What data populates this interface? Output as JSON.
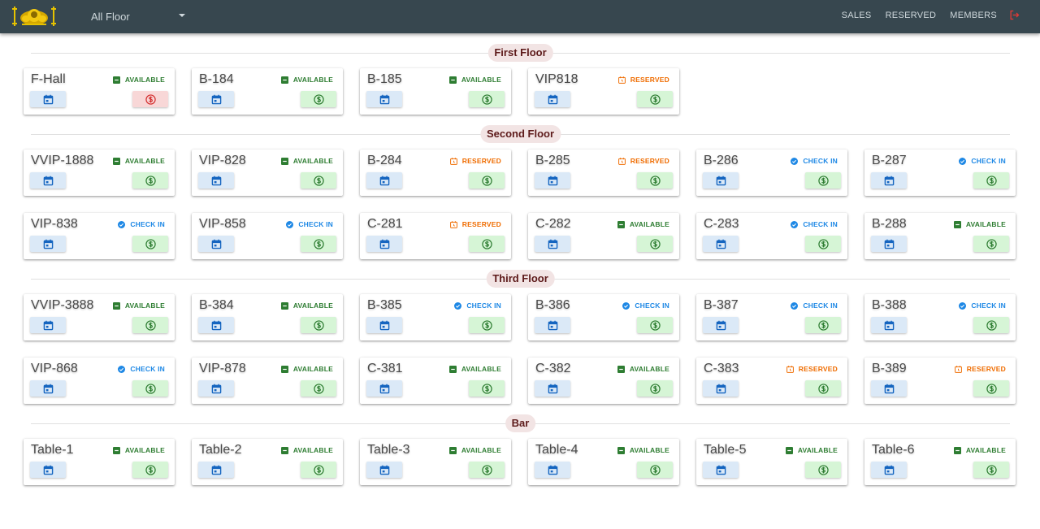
{
  "header": {
    "floor_select": "All Floor",
    "nav": [
      "SALES",
      "RESERVED",
      "MEMBERS"
    ]
  },
  "colors": {
    "topbar": "#37474f",
    "available": "#2e7d32",
    "reserved": "#ef6c00",
    "checkin": "#1e88e5",
    "calendar_button": "#dbe9f7",
    "pay_button": "#d6f5d6",
    "pay_button_busy": "#f8d7d7",
    "chip": "#f2e4e4"
  },
  "status_labels": {
    "available": "AVAILABLE",
    "reserved": "RESERVED",
    "checkin": "CHECK IN"
  },
  "sections": [
    {
      "title": "First Floor",
      "rows": [
        [
          {
            "name": "F-Hall",
            "status": "available",
            "pay": "busy"
          },
          {
            "name": "B-184",
            "status": "available"
          },
          {
            "name": "B-185",
            "status": "available"
          },
          {
            "name": "VIP818",
            "status": "reserved"
          }
        ]
      ]
    },
    {
      "title": "Second Floor",
      "rows": [
        [
          {
            "name": "VVIP-1888",
            "status": "available"
          },
          {
            "name": "VIP-828",
            "status": "available"
          },
          {
            "name": "B-284",
            "status": "reserved"
          },
          {
            "name": "B-285",
            "status": "reserved"
          },
          {
            "name": "B-286",
            "status": "checkin"
          },
          {
            "name": "B-287",
            "status": "checkin"
          }
        ],
        [
          {
            "name": "VIP-838",
            "status": "checkin"
          },
          {
            "name": "VIP-858",
            "status": "checkin"
          },
          {
            "name": "C-281",
            "status": "reserved"
          },
          {
            "name": "C-282",
            "status": "available"
          },
          {
            "name": "C-283",
            "status": "checkin"
          },
          {
            "name": "B-288",
            "status": "available"
          }
        ]
      ]
    },
    {
      "title": "Third Floor",
      "rows": [
        [
          {
            "name": "VVIP-3888",
            "status": "available"
          },
          {
            "name": "B-384",
            "status": "available"
          },
          {
            "name": "B-385",
            "status": "checkin"
          },
          {
            "name": "B-386",
            "status": "checkin"
          },
          {
            "name": "B-387",
            "status": "checkin"
          },
          {
            "name": "B-388",
            "status": "checkin"
          }
        ],
        [
          {
            "name": "VIP-868",
            "status": "checkin"
          },
          {
            "name": "VIP-878",
            "status": "available"
          },
          {
            "name": "C-381",
            "status": "available"
          },
          {
            "name": "C-382",
            "status": "available"
          },
          {
            "name": "C-383",
            "status": "reserved"
          },
          {
            "name": "B-389",
            "status": "reserved"
          }
        ]
      ]
    },
    {
      "title": "Bar",
      "rows": [
        [
          {
            "name": "Table-1",
            "status": "available"
          },
          {
            "name": "Table-2",
            "status": "available"
          },
          {
            "name": "Table-3",
            "status": "available"
          },
          {
            "name": "Table-4",
            "status": "available"
          },
          {
            "name": "Table-5",
            "status": "available"
          },
          {
            "name": "Table-6",
            "status": "available"
          }
        ]
      ]
    }
  ]
}
